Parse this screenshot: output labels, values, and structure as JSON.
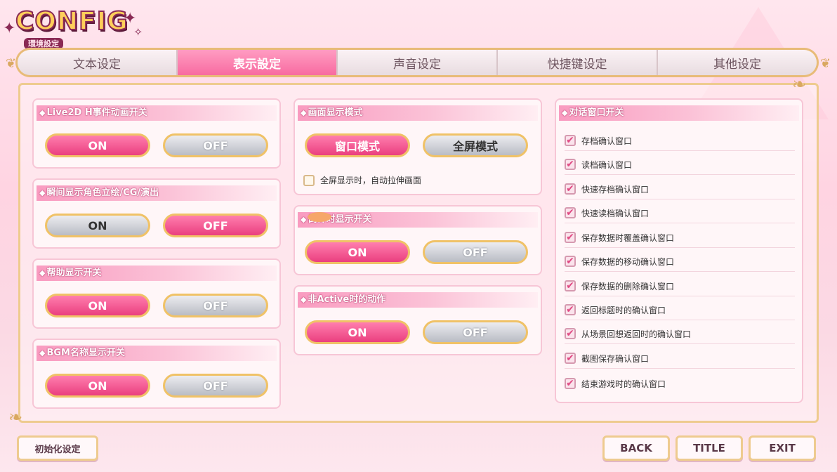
{
  "logo": {
    "title": "CONFIG",
    "subtitle": "環境設定"
  },
  "tabs": [
    {
      "label": "文本设定",
      "active": false
    },
    {
      "label": "表示設定",
      "active": true
    },
    {
      "label": "声音设定",
      "active": false
    },
    {
      "label": "快捷键设定",
      "active": false
    },
    {
      "label": "其他设定",
      "active": false
    }
  ],
  "left": {
    "live2d": {
      "title": "Live2D H事件动画开关",
      "on": "ON",
      "off": "OFF",
      "selected": "ON"
    },
    "instant": {
      "title": "瞬间显示角色立绘/CG/演出",
      "on": "ON",
      "off": "OFF",
      "selected": "OFF"
    },
    "help": {
      "title": "帮助显示开关",
      "on": "ON",
      "off": "OFF",
      "selected": "ON"
    },
    "bgm": {
      "title": "BGM名称显示开关",
      "on": "ON",
      "off": "OFF",
      "selected": "ON"
    }
  },
  "middle": {
    "screen": {
      "title": "画面显示模式",
      "window": "窗口模式",
      "fullscreen": "全屏模式",
      "selected": "窗口模式",
      "stretch_label": "全屏显示时，自动拉伸画面",
      "stretch_checked": false
    },
    "countdown": {
      "title": "倒计时显示开关",
      "on": "ON",
      "off": "OFF",
      "selected": "ON"
    },
    "inactive": {
      "title": "非Active时的动作",
      "on": "ON",
      "off": "OFF",
      "selected": "ON"
    }
  },
  "right": {
    "title": "对话窗口开关",
    "items": [
      {
        "label": "存档确认窗口",
        "checked": true
      },
      {
        "label": "读档确认窗口",
        "checked": true
      },
      {
        "label": "快速存档确认窗口",
        "checked": true
      },
      {
        "label": "快速读档确认窗口",
        "checked": true
      },
      {
        "label": "保存数据时覆盖确认窗口",
        "checked": true
      },
      {
        "label": "保存数据的移动确认窗口",
        "checked": true
      },
      {
        "label": "保存数据的删除确认窗口",
        "checked": true
      },
      {
        "label": "返回标题时的确认窗口",
        "checked": true
      },
      {
        "label": "从场景回想返回时的确认窗口",
        "checked": true
      },
      {
        "label": "截图保存确认窗口",
        "checked": true
      },
      {
        "label": "结束游戏时的确认窗口",
        "checked": true
      }
    ]
  },
  "bottom": {
    "reset": "初始化设定",
    "back": "BACK",
    "title": "TITLE",
    "exit": "EXIT"
  },
  "icons": {
    "diamond": "◆",
    "check": "✔"
  }
}
